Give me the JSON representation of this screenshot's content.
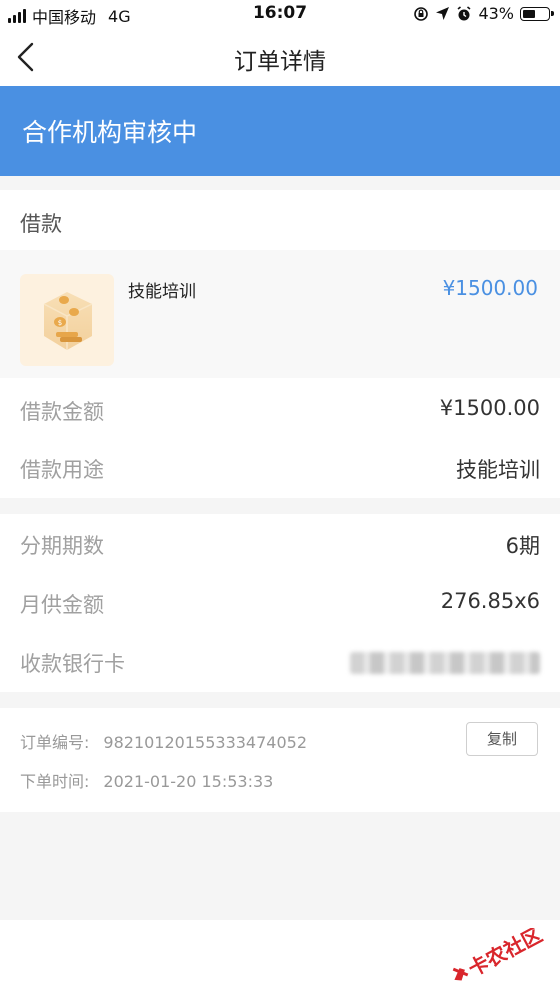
{
  "status_bar": {
    "carrier": "中国移动",
    "network": "4G",
    "time": "16:07",
    "battery": "43%"
  },
  "nav": {
    "title": "订单详情"
  },
  "banner": {
    "status_text": "合作机构审核中"
  },
  "loan_section": {
    "title": "借款",
    "product": {
      "name": "技能培训",
      "price": "¥1500.00"
    }
  },
  "details": [
    {
      "label": "借款金额",
      "value": "¥1500.00"
    },
    {
      "label": "借款用途",
      "value": "技能培训"
    }
  ],
  "installments": [
    {
      "label": "分期期数",
      "value": "6期"
    },
    {
      "label": "月供金额",
      "value": "276.85x6"
    },
    {
      "label": "收款银行卡",
      "value": ""
    }
  ],
  "order_info": {
    "number_label": "订单编号:",
    "number_value": "98210120155333474052",
    "time_label": "下单时间:",
    "time_value": "2021-01-20 15:53:33",
    "copy_label": "复制"
  },
  "watermark": {
    "text": "卡农社区"
  },
  "colors": {
    "accent": "#4a90e2",
    "watermark_red": "#d9262c"
  }
}
